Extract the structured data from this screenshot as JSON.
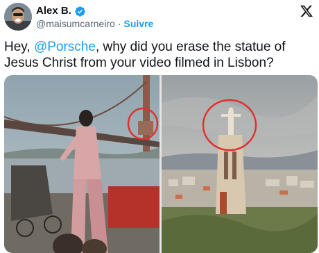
{
  "author": {
    "display_name": "Alex B.",
    "handle": "@maisumcarneiro",
    "separator": "·",
    "follow_label": "Suivre",
    "verified_icon": "verified-badge-icon",
    "avatar": "avatar"
  },
  "platform_logo": "x-logo-icon",
  "tweet": {
    "greeting": "Hey,",
    "mention": "@Porsche",
    "text_rest": ", why did you erase the statue of Jesus Christ from your video filmed in Lisbon?"
  },
  "colors": {
    "link_blue": "#1d9bf0",
    "text_primary": "#0f1419",
    "text_secondary": "#536471",
    "highlight_red": "#e0312e"
  },
  "media": {
    "left_image": "porsche-video-frame-bridge",
    "right_image": "cristo-rei-statue-photo"
  }
}
